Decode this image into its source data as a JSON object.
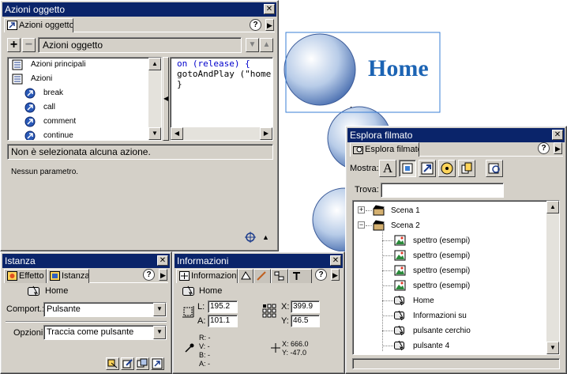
{
  "colors": {
    "titlebar": "#0a246a",
    "panel": "#d4d0c8",
    "stage_text": "#1c64b4",
    "selection": "#6b88c8"
  },
  "stage": {
    "title": "Home"
  },
  "actions_panel": {
    "title": "Azioni oggetto",
    "tab": "Azioni oggetto",
    "help": "?",
    "dropdown": "Azioni oggetto",
    "add_label": "+",
    "remove_label": "−",
    "toolbox": [
      {
        "label": "Azioni principali",
        "icon": "book-icon",
        "kind": "category"
      },
      {
        "label": "Azioni",
        "icon": "book-icon",
        "kind": "category"
      },
      {
        "label": "break",
        "icon": "action-icon",
        "kind": "action"
      },
      {
        "label": "call",
        "icon": "action-icon",
        "kind": "action"
      },
      {
        "label": "comment",
        "icon": "action-icon",
        "kind": "action"
      },
      {
        "label": "continue",
        "icon": "action-icon",
        "kind": "action"
      }
    ],
    "script": [
      "on (release) {",
      " gotoAndPlay (\"home\"",
      "}"
    ],
    "status": "Non è selezionata alcuna azione.",
    "params": "Nessun parametro."
  },
  "instance_panel": {
    "title": "Istanza",
    "tabs": [
      "Effetto",
      "Istanza"
    ],
    "help": "?",
    "symbol_name": "Home",
    "behavior_label": "Comport.:",
    "behavior_value": "Pulsante",
    "options_label": "Opzioni:",
    "options_value": "Traccia come pulsante"
  },
  "info_panel": {
    "title": "Informazioni",
    "tab": "Informazioni",
    "help": "?",
    "symbol_name": "Home",
    "l_label": "L:",
    "l_value": "195.2",
    "a_label": "A:",
    "a_value": "101.1",
    "x_label": "X:",
    "x_value": "399.9",
    "y_label": "Y:",
    "y_value": "46.5",
    "r_text": "R: -",
    "v_text": "V: -",
    "b_text": "B: -",
    "alpha_text": "A: -",
    "cursor_x": "X:  666.0",
    "cursor_y": "Y:  -47.0"
  },
  "movie_explorer": {
    "title": "Esplora filmato",
    "tab": "Esplora filmato",
    "help": "?",
    "show_label": "Mostra:",
    "find_label": "Trova:",
    "find_value": "",
    "tree": [
      {
        "label": "Scena 1",
        "level": 0,
        "expander": "+",
        "icon": "scene-icon"
      },
      {
        "label": "Scena 2",
        "level": 0,
        "expander": "−",
        "icon": "scene-icon"
      },
      {
        "label": "spettro (esempi)",
        "level": 1,
        "icon": "bitmap-icon"
      },
      {
        "label": "spettro (esempi)",
        "level": 1,
        "icon": "bitmap-icon"
      },
      {
        "label": "spettro (esempi)",
        "level": 1,
        "icon": "bitmap-icon"
      },
      {
        "label": "spettro (esempi)",
        "level": 1,
        "icon": "bitmap-icon"
      },
      {
        "label": "Home",
        "level": 1,
        "icon": "button-symbol-icon"
      },
      {
        "label": "Informazioni su",
        "level": 1,
        "icon": "button-symbol-icon"
      },
      {
        "label": "pulsante cerchio",
        "level": 1,
        "icon": "button-symbol-icon"
      },
      {
        "label": "pulsante 4",
        "level": 1,
        "icon": "button-symbol-icon"
      }
    ]
  }
}
